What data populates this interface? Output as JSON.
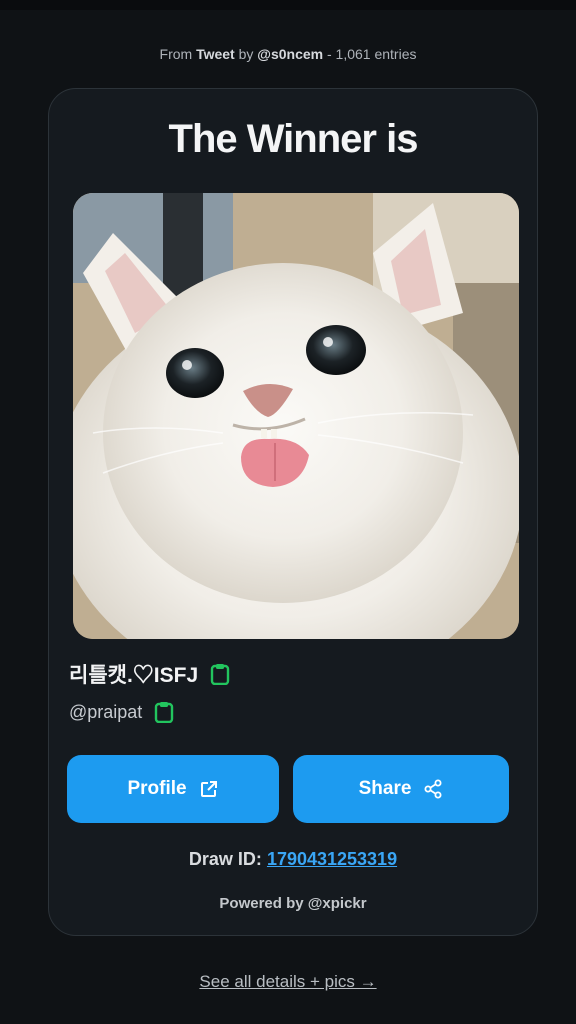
{
  "header": {
    "prefix": "From",
    "source": "Tweet",
    "by": "by",
    "author": "@s0ncem",
    "entries": "- 1,061 entries"
  },
  "card": {
    "title": "The Winner is",
    "winner_name": "리틀캣.♡ISFJ",
    "winner_handle": "@praipat",
    "profile_label": "Profile",
    "share_label": "Share",
    "draw_label": "Draw ID:",
    "draw_id": "1790431253319",
    "powered_by": "Powered by @xpickr"
  },
  "footer": {
    "link": "See all details + pics →"
  },
  "icons": {
    "copy": "clipboard-icon",
    "profile": "external-link-icon",
    "share": "share-icon"
  },
  "colors": {
    "background": "#0f1215",
    "card": "#151a1f",
    "accent": "#1d9bf0",
    "copy_icon": "#22c55e",
    "link": "#3aa6f5"
  }
}
